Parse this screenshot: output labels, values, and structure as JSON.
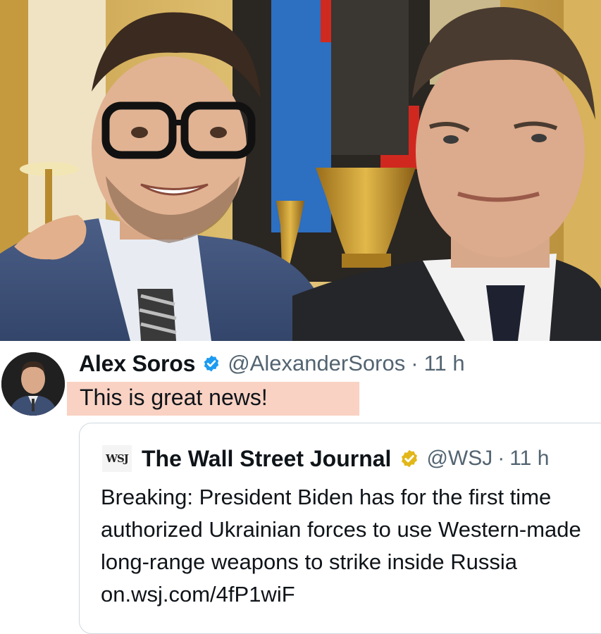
{
  "photo": {
    "description_icon": "photo-of-two-men-icon"
  },
  "tweet": {
    "author_name": "Alex Soros",
    "verified_icon": "verified-badge-blue-icon",
    "handle": "@AlexanderSoros",
    "separator": "·",
    "time": "11 h",
    "text": "This is great news!",
    "highlight_color": "#f9d2c3"
  },
  "quote": {
    "logo_text": "WSJ",
    "author_name": "The Wall Street Journal",
    "verified_icon": "verified-badge-gold-icon",
    "handle": "@WSJ",
    "separator": "·",
    "time": "11 h",
    "body": "Breaking: President Biden has for the first time authorized Ukrainian forces to use Western-made long-range weapons to strike inside Russia on.wsj.com/4fP1wiF"
  }
}
